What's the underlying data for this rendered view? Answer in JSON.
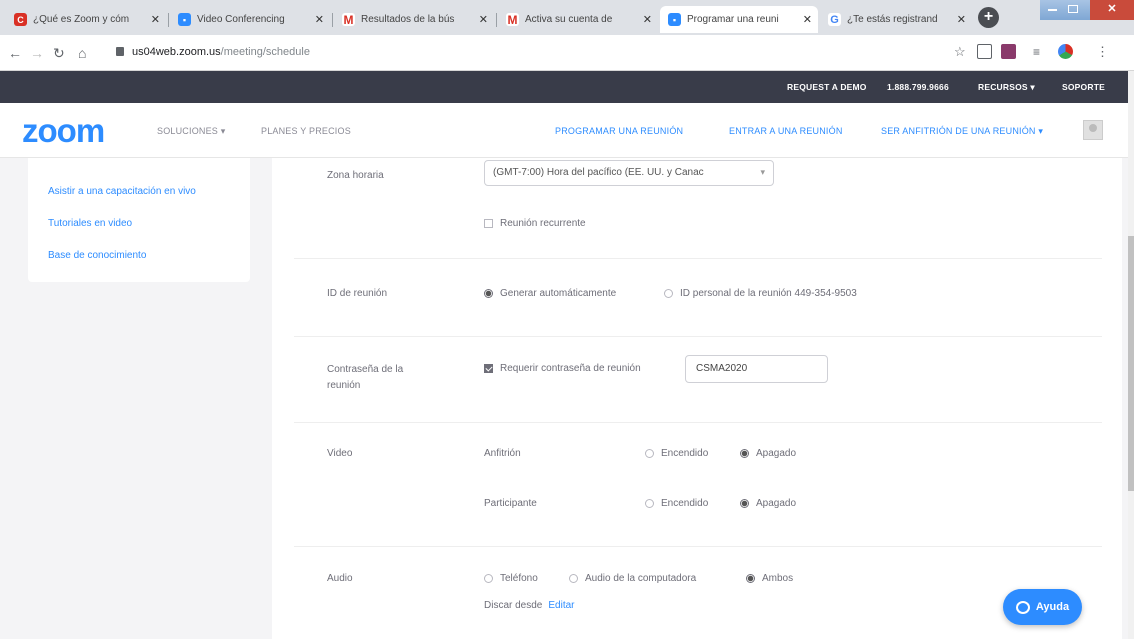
{
  "browser": {
    "tabs": [
      {
        "title": "¿Qué es Zoom y cóm",
        "icon": "c-icon",
        "color": "#d93025",
        "active": false
      },
      {
        "title": "Video Conferencing",
        "icon": "zoom-icon",
        "color": "#2d8cff",
        "active": false
      },
      {
        "title": "Resultados de la bús",
        "icon": "gmail-icon",
        "color": "#d93025",
        "active": false
      },
      {
        "title": "Activa su cuenta de",
        "icon": "gmail-icon",
        "color": "#d93025",
        "active": false
      },
      {
        "title": "Programar una reuni",
        "icon": "zoom-icon",
        "color": "#2d8cff",
        "active": true
      },
      {
        "title": "¿Te estás registrand",
        "icon": "google-icon",
        "color": "#4285f4",
        "active": false
      }
    ],
    "url_host": "us04web.zoom.us",
    "url_path": "/meeting/schedule"
  },
  "topbar": {
    "request_demo": "REQUEST A DEMO",
    "phone": "1.888.799.9666",
    "resources": "RECURSOS ▾",
    "support": "SOPORTE"
  },
  "nav": {
    "logo": "zoom",
    "solutions": "SOLUCIONES ▾",
    "plans": "PLANES Y PRECIOS",
    "schedule": "PROGRAMAR UNA REUNIÓN",
    "join": "ENTRAR A UNA REUNIÓN",
    "host": "SER ANFITRIÓN DE UNA REUNIÓN ▾"
  },
  "sidebar": {
    "links": [
      "Asistir a una capacitación en vivo",
      "Tutoriales en video",
      "Base de conocimiento"
    ]
  },
  "form": {
    "timezone_label": "Zona horaria",
    "timezone_value": "(GMT-7:00) Hora del pacífico (EE. UU. y Canac",
    "recurring_label": "Reunión recurrente",
    "meeting_id_label": "ID de reunión",
    "meeting_id_auto": "Generar automáticamente",
    "meeting_id_personal": "ID personal de la reunión 449-354-9503",
    "password_label": "Contraseña de la reunión",
    "password_require": "Requerir contraseña de reunión",
    "password_value": "CSMA2020",
    "video_label": "Video",
    "host_label": "Anfitrión",
    "participant_label": "Participante",
    "on": "Encendido",
    "off": "Apagado",
    "audio_label": "Audio",
    "audio_phone": "Teléfono",
    "audio_computer": "Audio de la computadora",
    "audio_both": "Ambos",
    "dial_from": "Discar desde",
    "edit": "Editar"
  },
  "help": {
    "label": "Ayuda"
  }
}
